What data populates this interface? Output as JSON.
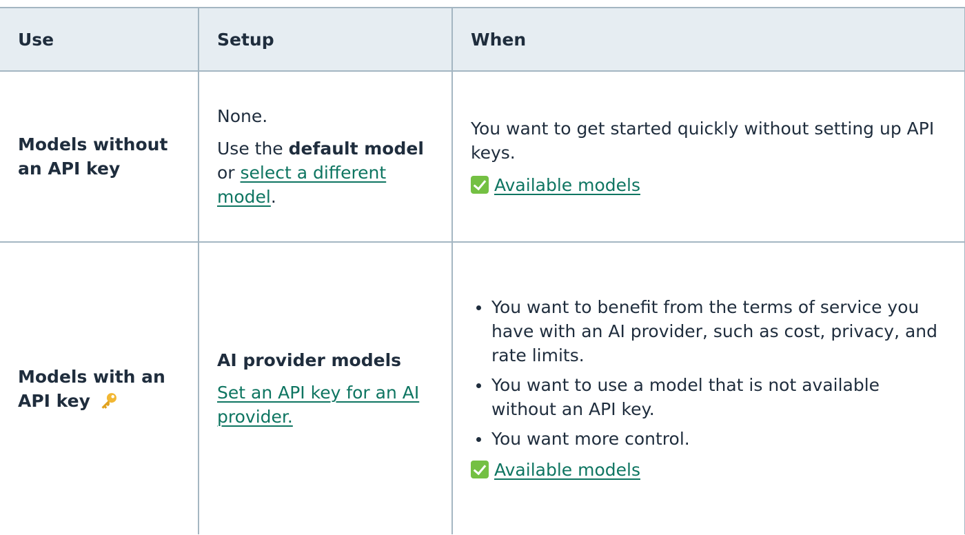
{
  "table": {
    "headers": {
      "use": "Use",
      "setup": "Setup",
      "when": "When"
    },
    "rows": [
      {
        "use": "Models without an API key",
        "setup": {
          "first": "None.",
          "prefix": "Use the ",
          "bold": "default model",
          "middle": " or ",
          "link": "select a different model",
          "suffix": "."
        },
        "when": {
          "text": "You want to get started quickly without setting up API keys.",
          "link": "Available models"
        }
      },
      {
        "use": "Models with an API key",
        "use_icon": "key-icon",
        "setup": {
          "bold": "AI provider models",
          "link": "Set an API key for an AI provider."
        },
        "when": {
          "bullets": [
            "You want to benefit from the terms of service you have with an AI provider, such as cost, privacy, and rate limits.",
            "You want to use a model that is not available without an API key.",
            "You want more control."
          ],
          "link": "Available models"
        }
      }
    ]
  },
  "icons": {
    "check": "check-mark-button-icon",
    "key": "key-icon"
  },
  "colors": {
    "link": "#0e7561",
    "header_bg": "#e6edf2",
    "border": "#a4b6c2",
    "check": "#74c043",
    "key": "#f2b733"
  }
}
